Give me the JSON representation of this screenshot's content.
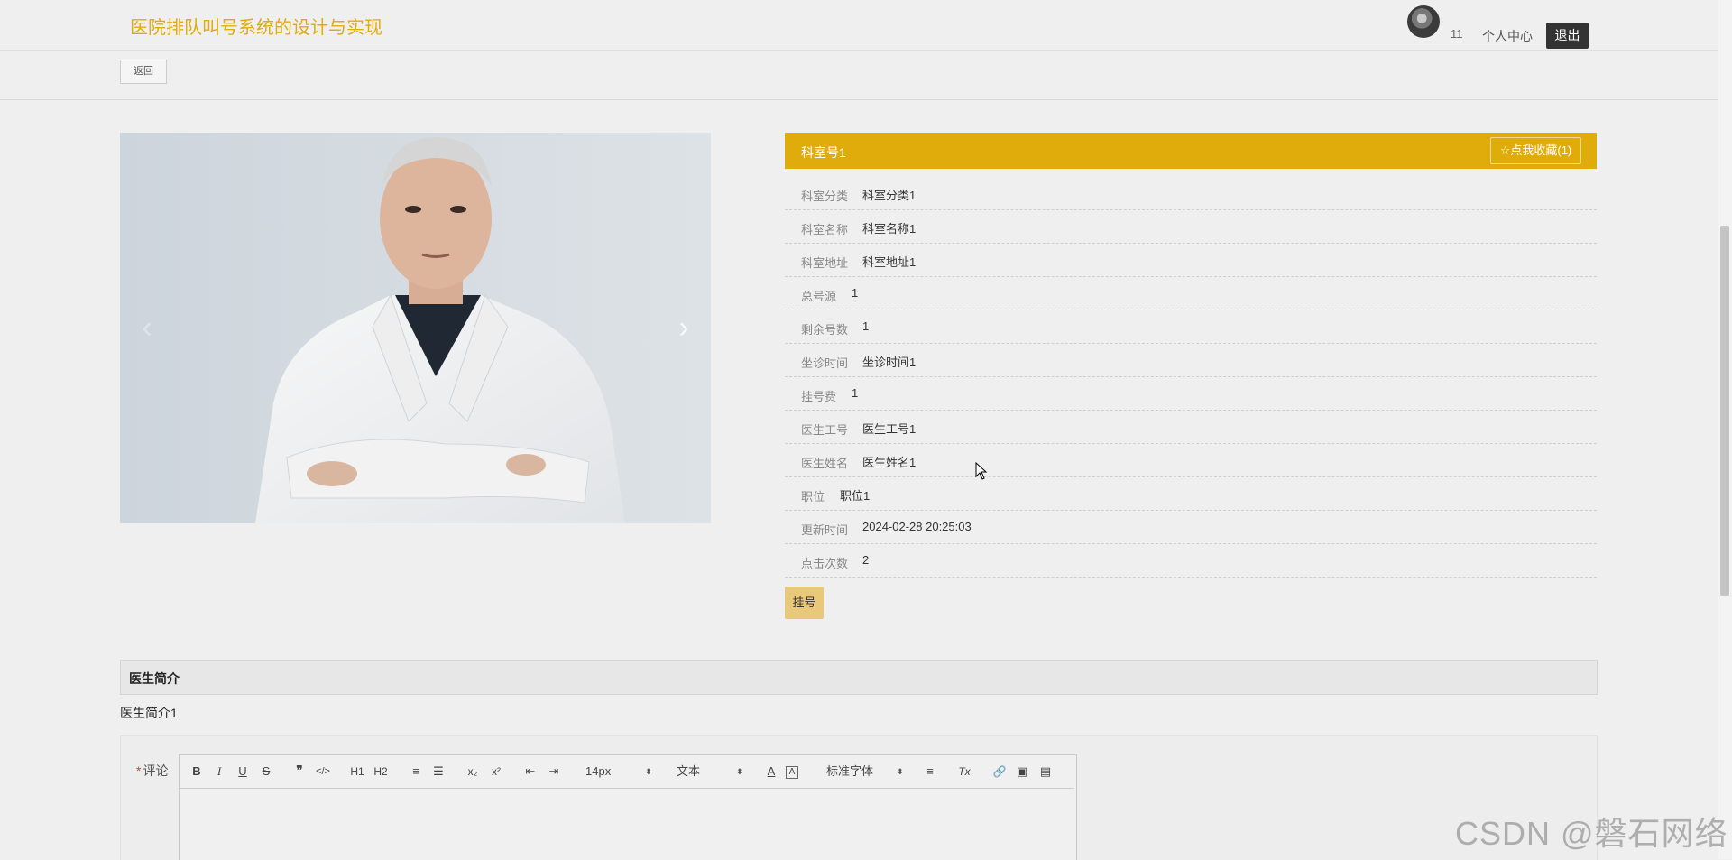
{
  "header": {
    "site_title": "医院排队叫号系统的设计与实现",
    "username": "11",
    "personal_center": "个人中心",
    "logout": "退出"
  },
  "back_label": "返回",
  "carousel": {
    "prev_icon": "chevron-left-icon",
    "next_icon": "chevron-right-icon"
  },
  "detail": {
    "title": "科室号1",
    "favorite": "☆点我收藏(1)",
    "fields": [
      {
        "label": "科室分类",
        "value": "科室分类1"
      },
      {
        "label": "科室名称",
        "value": "科室名称1"
      },
      {
        "label": "科室地址",
        "value": "科室地址1"
      },
      {
        "label": "总号源",
        "value": "1"
      },
      {
        "label": "剩余号数",
        "value": "1"
      },
      {
        "label": "坐诊时间",
        "value": "坐诊时间1"
      },
      {
        "label": "挂号费",
        "value": "1"
      },
      {
        "label": "医生工号",
        "value": "医生工号1"
      },
      {
        "label": "医生姓名",
        "value": "医生姓名1"
      },
      {
        "label": "职位",
        "value": "职位1"
      },
      {
        "label": "更新时间",
        "value": "2024-02-28 20:25:03"
      },
      {
        "label": "点击次数",
        "value": "2"
      }
    ],
    "register_button": "挂号"
  },
  "intro": {
    "title": "医生简介",
    "text": "医生简介1"
  },
  "comment": {
    "required_mark": "*",
    "label": "评论",
    "toolbar": {
      "bold": "B",
      "italic": "I",
      "underline": "U",
      "strike": "S",
      "blockquote": "❞",
      "code": "</>",
      "h1": "H1",
      "h2": "H2",
      "ordered_list": "≡",
      "bullet_list": "☰",
      "sub": "x₂",
      "sup": "x²",
      "outdent": "⇤",
      "indent": "⇥",
      "size": "14px",
      "header": "文本",
      "color": "A",
      "background": "A",
      "font": "标准字体",
      "align": "≡",
      "clean": "Tx",
      "link": "🔗",
      "image": "▣",
      "video": "▤"
    }
  },
  "watermark": "CSDN @磐石网络",
  "colors": {
    "accent": "#e0ac0c",
    "button_light": "#e8c979",
    "logout_bg": "#333333"
  }
}
